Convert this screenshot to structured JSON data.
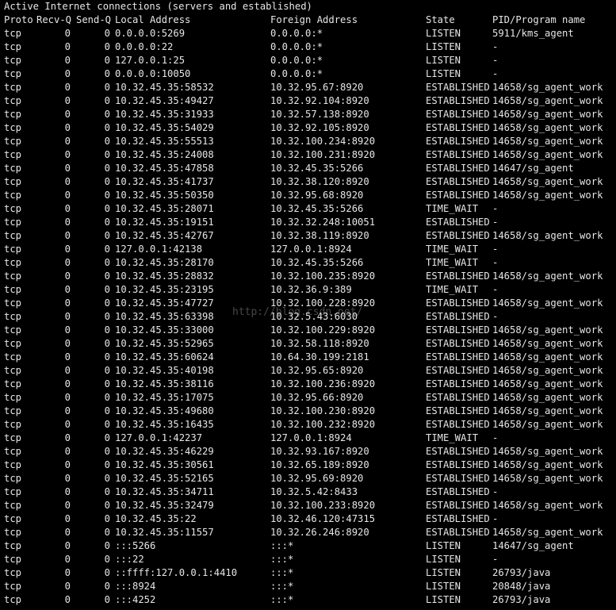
{
  "terminal": {
    "title": "Active Internet connections (servers and established)",
    "headers": {
      "proto": "Proto",
      "recv_q": "Recv-Q",
      "send_q": "Send-Q",
      "local": "Local Address",
      "foreign": "Foreign Address",
      "state": "State",
      "pid": "PID/Program name"
    },
    "rows": [
      {
        "proto": "tcp",
        "recv": "0",
        "send": "0",
        "local": "0.0.0.0:5269",
        "foreign": "0.0.0.0:*",
        "state": "LISTEN",
        "pid": "5911/kms_agent"
      },
      {
        "proto": "tcp",
        "recv": "0",
        "send": "0",
        "local": "0.0.0.0:22",
        "foreign": "0.0.0.0:*",
        "state": "LISTEN",
        "pid": "-"
      },
      {
        "proto": "tcp",
        "recv": "0",
        "send": "0",
        "local": "127.0.0.1:25",
        "foreign": "0.0.0.0:*",
        "state": "LISTEN",
        "pid": "-"
      },
      {
        "proto": "tcp",
        "recv": "0",
        "send": "0",
        "local": "0.0.0.0:10050",
        "foreign": "0.0.0.0:*",
        "state": "LISTEN",
        "pid": "-"
      },
      {
        "proto": "tcp",
        "recv": "0",
        "send": "0",
        "local": "10.32.45.35:58532",
        "foreign": "10.32.95.67:8920",
        "state": "ESTABLISHED",
        "pid": "14658/sg_agent_work"
      },
      {
        "proto": "tcp",
        "recv": "0",
        "send": "0",
        "local": "10.32.45.35:49427",
        "foreign": "10.32.92.104:8920",
        "state": "ESTABLISHED",
        "pid": "14658/sg_agent_work"
      },
      {
        "proto": "tcp",
        "recv": "0",
        "send": "0",
        "local": "10.32.45.35:31933",
        "foreign": "10.32.57.138:8920",
        "state": "ESTABLISHED",
        "pid": "14658/sg_agent_work"
      },
      {
        "proto": "tcp",
        "recv": "0",
        "send": "0",
        "local": "10.32.45.35:54029",
        "foreign": "10.32.92.105:8920",
        "state": "ESTABLISHED",
        "pid": "14658/sg_agent_work"
      },
      {
        "proto": "tcp",
        "recv": "0",
        "send": "0",
        "local": "10.32.45.35:55513",
        "foreign": "10.32.100.234:8920",
        "state": "ESTABLISHED",
        "pid": "14658/sg_agent_work"
      },
      {
        "proto": "tcp",
        "recv": "0",
        "send": "0",
        "local": "10.32.45.35:24008",
        "foreign": "10.32.100.231:8920",
        "state": "ESTABLISHED",
        "pid": "14658/sg_agent_work"
      },
      {
        "proto": "tcp",
        "recv": "0",
        "send": "0",
        "local": "10.32.45.35:47858",
        "foreign": "10.32.45.35:5266",
        "state": "ESTABLISHED",
        "pid": "14647/sg_agent"
      },
      {
        "proto": "tcp",
        "recv": "0",
        "send": "0",
        "local": "10.32.45.35:41737",
        "foreign": "10.32.38.120:8920",
        "state": "ESTABLISHED",
        "pid": "14658/sg_agent_work"
      },
      {
        "proto": "tcp",
        "recv": "0",
        "send": "0",
        "local": "10.32.45.35:50350",
        "foreign": "10.32.95.68:8920",
        "state": "ESTABLISHED",
        "pid": "14658/sg_agent_work"
      },
      {
        "proto": "tcp",
        "recv": "0",
        "send": "0",
        "local": "10.32.45.35:28071",
        "foreign": "10.32.45.35:5266",
        "state": "TIME_WAIT",
        "pid": "-"
      },
      {
        "proto": "tcp",
        "recv": "0",
        "send": "0",
        "local": "10.32.45.35:19151",
        "foreign": "10.32.32.248:10051",
        "state": "ESTABLISHED",
        "pid": "-"
      },
      {
        "proto": "tcp",
        "recv": "0",
        "send": "0",
        "local": "10.32.45.35:42767",
        "foreign": "10.32.38.119:8920",
        "state": "ESTABLISHED",
        "pid": "14658/sg_agent_work"
      },
      {
        "proto": "tcp",
        "recv": "0",
        "send": "0",
        "local": "127.0.0.1:42138",
        "foreign": "127.0.0.1:8924",
        "state": "TIME_WAIT",
        "pid": "-"
      },
      {
        "proto": "tcp",
        "recv": "0",
        "send": "0",
        "local": "10.32.45.35:28170",
        "foreign": "10.32.45.35:5266",
        "state": "TIME_WAIT",
        "pid": "-"
      },
      {
        "proto": "tcp",
        "recv": "0",
        "send": "0",
        "local": "10.32.45.35:28832",
        "foreign": "10.32.100.235:8920",
        "state": "ESTABLISHED",
        "pid": "14658/sg_agent_work"
      },
      {
        "proto": "tcp",
        "recv": "0",
        "send": "0",
        "local": "10.32.45.35:23195",
        "foreign": "10.32.36.9:389",
        "state": "TIME_WAIT",
        "pid": "-"
      },
      {
        "proto": "tcp",
        "recv": "0",
        "send": "0",
        "local": "10.32.45.35:47727",
        "foreign": "10.32.100.228:8920",
        "state": "ESTABLISHED",
        "pid": "14658/sg_agent_work"
      },
      {
        "proto": "tcp",
        "recv": "0",
        "send": "0",
        "local": "10.32.45.35:63398",
        "foreign": "10.32.5.43:6030",
        "state": "ESTABLISHED",
        "pid": "-"
      },
      {
        "proto": "tcp",
        "recv": "0",
        "send": "0",
        "local": "10.32.45.35:33000",
        "foreign": "10.32.100.229:8920",
        "state": "ESTABLISHED",
        "pid": "14658/sg_agent_work"
      },
      {
        "proto": "tcp",
        "recv": "0",
        "send": "0",
        "local": "10.32.45.35:52965",
        "foreign": "10.32.58.118:8920",
        "state": "ESTABLISHED",
        "pid": "14658/sg_agent_work"
      },
      {
        "proto": "tcp",
        "recv": "0",
        "send": "0",
        "local": "10.32.45.35:60624",
        "foreign": "10.64.30.199:2181",
        "state": "ESTABLISHED",
        "pid": "14658/sg_agent_work"
      },
      {
        "proto": "tcp",
        "recv": "0",
        "send": "0",
        "local": "10.32.45.35:40198",
        "foreign": "10.32.95.65:8920",
        "state": "ESTABLISHED",
        "pid": "14658/sg_agent_work"
      },
      {
        "proto": "tcp",
        "recv": "0",
        "send": "0",
        "local": "10.32.45.35:38116",
        "foreign": "10.32.100.236:8920",
        "state": "ESTABLISHED",
        "pid": "14658/sg_agent_work"
      },
      {
        "proto": "tcp",
        "recv": "0",
        "send": "0",
        "local": "10.32.45.35:17075",
        "foreign": "10.32.95.66:8920",
        "state": "ESTABLISHED",
        "pid": "14658/sg_agent_work"
      },
      {
        "proto": "tcp",
        "recv": "0",
        "send": "0",
        "local": "10.32.45.35:49680",
        "foreign": "10.32.100.230:8920",
        "state": "ESTABLISHED",
        "pid": "14658/sg_agent_work"
      },
      {
        "proto": "tcp",
        "recv": "0",
        "send": "0",
        "local": "10.32.45.35:16435",
        "foreign": "10.32.100.232:8920",
        "state": "ESTABLISHED",
        "pid": "14658/sg_agent_work"
      },
      {
        "proto": "tcp",
        "recv": "0",
        "send": "0",
        "local": "127.0.0.1:42237",
        "foreign": "127.0.0.1:8924",
        "state": "TIME_WAIT",
        "pid": "-"
      },
      {
        "proto": "tcp",
        "recv": "0",
        "send": "0",
        "local": "10.32.45.35:46229",
        "foreign": "10.32.93.167:8920",
        "state": "ESTABLISHED",
        "pid": "14658/sg_agent_work"
      },
      {
        "proto": "tcp",
        "recv": "0",
        "send": "0",
        "local": "10.32.45.35:30561",
        "foreign": "10.32.65.189:8920",
        "state": "ESTABLISHED",
        "pid": "14658/sg_agent_work"
      },
      {
        "proto": "tcp",
        "recv": "0",
        "send": "0",
        "local": "10.32.45.35:52165",
        "foreign": "10.32.95.69:8920",
        "state": "ESTABLISHED",
        "pid": "14658/sg_agent_work"
      },
      {
        "proto": "tcp",
        "recv": "0",
        "send": "0",
        "local": "10.32.45.35:34711",
        "foreign": "10.32.5.42:8433",
        "state": "ESTABLISHED",
        "pid": "-"
      },
      {
        "proto": "tcp",
        "recv": "0",
        "send": "0",
        "local": "10.32.45.35:32479",
        "foreign": "10.32.100.233:8920",
        "state": "ESTABLISHED",
        "pid": "14658/sg_agent_work"
      },
      {
        "proto": "tcp",
        "recv": "0",
        "send": "0",
        "local": "10.32.45.35:22",
        "foreign": "10.32.46.120:47315",
        "state": "ESTABLISHED",
        "pid": "-"
      },
      {
        "proto": "tcp",
        "recv": "0",
        "send": "0",
        "local": "10.32.45.35:11557",
        "foreign": "10.32.26.246:8920",
        "state": "ESTABLISHED",
        "pid": "14658/sg_agent_work"
      },
      {
        "proto": "tcp",
        "recv": "0",
        "send": "0",
        "local": ":::5266",
        "foreign": ":::*",
        "state": "LISTEN",
        "pid": "14647/sg_agent"
      },
      {
        "proto": "tcp",
        "recv": "0",
        "send": "0",
        "local": ":::22",
        "foreign": ":::*",
        "state": "LISTEN",
        "pid": "-"
      },
      {
        "proto": "tcp",
        "recv": "0",
        "send": "0",
        "local": "::ffff:127.0.0.1:4410",
        "foreign": ":::*",
        "state": "LISTEN",
        "pid": "26793/java"
      },
      {
        "proto": "tcp",
        "recv": "0",
        "send": "0",
        "local": ":::8924",
        "foreign": ":::*",
        "state": "LISTEN",
        "pid": "20848/java"
      },
      {
        "proto": "tcp",
        "recv": "0",
        "send": "0",
        "local": ":::4252",
        "foreign": ":::*",
        "state": "LISTEN",
        "pid": "26793/java"
      }
    ],
    "watermark": "http://blog.csdn.net/",
    "colors": {
      "background": "#000000",
      "text": "#e6e6e6"
    }
  }
}
